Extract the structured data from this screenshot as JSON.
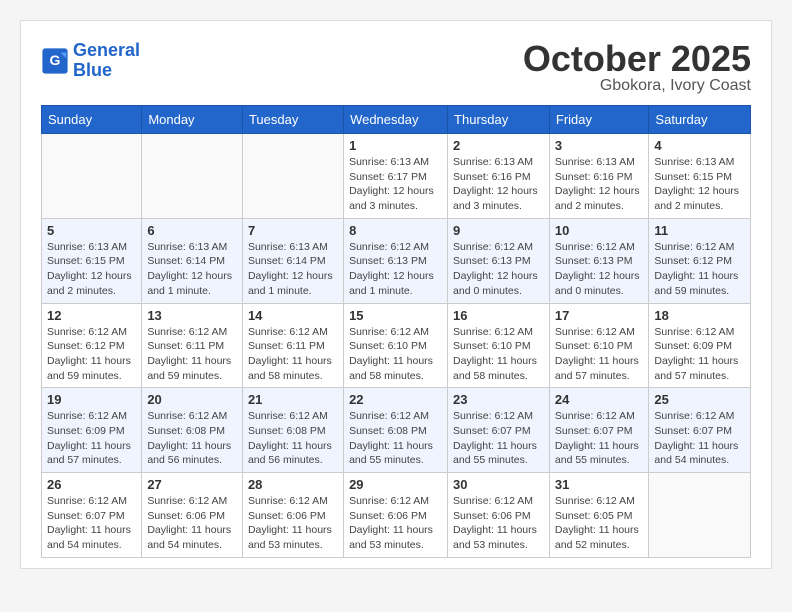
{
  "header": {
    "logo_text_general": "General",
    "logo_text_blue": "Blue",
    "month": "October 2025",
    "location": "Gbokora, Ivory Coast"
  },
  "weekdays": [
    "Sunday",
    "Monday",
    "Tuesday",
    "Wednesday",
    "Thursday",
    "Friday",
    "Saturday"
  ],
  "weeks": [
    [
      {
        "day": "",
        "info": ""
      },
      {
        "day": "",
        "info": ""
      },
      {
        "day": "",
        "info": ""
      },
      {
        "day": "1",
        "info": "Sunrise: 6:13 AM\nSunset: 6:17 PM\nDaylight: 12 hours and 3 minutes."
      },
      {
        "day": "2",
        "info": "Sunrise: 6:13 AM\nSunset: 6:16 PM\nDaylight: 12 hours and 3 minutes."
      },
      {
        "day": "3",
        "info": "Sunrise: 6:13 AM\nSunset: 6:16 PM\nDaylight: 12 hours and 2 minutes."
      },
      {
        "day": "4",
        "info": "Sunrise: 6:13 AM\nSunset: 6:15 PM\nDaylight: 12 hours and 2 minutes."
      }
    ],
    [
      {
        "day": "5",
        "info": "Sunrise: 6:13 AM\nSunset: 6:15 PM\nDaylight: 12 hours and 2 minutes."
      },
      {
        "day": "6",
        "info": "Sunrise: 6:13 AM\nSunset: 6:14 PM\nDaylight: 12 hours and 1 minute."
      },
      {
        "day": "7",
        "info": "Sunrise: 6:13 AM\nSunset: 6:14 PM\nDaylight: 12 hours and 1 minute."
      },
      {
        "day": "8",
        "info": "Sunrise: 6:12 AM\nSunset: 6:13 PM\nDaylight: 12 hours and 1 minute."
      },
      {
        "day": "9",
        "info": "Sunrise: 6:12 AM\nSunset: 6:13 PM\nDaylight: 12 hours and 0 minutes."
      },
      {
        "day": "10",
        "info": "Sunrise: 6:12 AM\nSunset: 6:13 PM\nDaylight: 12 hours and 0 minutes."
      },
      {
        "day": "11",
        "info": "Sunrise: 6:12 AM\nSunset: 6:12 PM\nDaylight: 11 hours and 59 minutes."
      }
    ],
    [
      {
        "day": "12",
        "info": "Sunrise: 6:12 AM\nSunset: 6:12 PM\nDaylight: 11 hours and 59 minutes."
      },
      {
        "day": "13",
        "info": "Sunrise: 6:12 AM\nSunset: 6:11 PM\nDaylight: 11 hours and 59 minutes."
      },
      {
        "day": "14",
        "info": "Sunrise: 6:12 AM\nSunset: 6:11 PM\nDaylight: 11 hours and 58 minutes."
      },
      {
        "day": "15",
        "info": "Sunrise: 6:12 AM\nSunset: 6:10 PM\nDaylight: 11 hours and 58 minutes."
      },
      {
        "day": "16",
        "info": "Sunrise: 6:12 AM\nSunset: 6:10 PM\nDaylight: 11 hours and 58 minutes."
      },
      {
        "day": "17",
        "info": "Sunrise: 6:12 AM\nSunset: 6:10 PM\nDaylight: 11 hours and 57 minutes."
      },
      {
        "day": "18",
        "info": "Sunrise: 6:12 AM\nSunset: 6:09 PM\nDaylight: 11 hours and 57 minutes."
      }
    ],
    [
      {
        "day": "19",
        "info": "Sunrise: 6:12 AM\nSunset: 6:09 PM\nDaylight: 11 hours and 57 minutes."
      },
      {
        "day": "20",
        "info": "Sunrise: 6:12 AM\nSunset: 6:08 PM\nDaylight: 11 hours and 56 minutes."
      },
      {
        "day": "21",
        "info": "Sunrise: 6:12 AM\nSunset: 6:08 PM\nDaylight: 11 hours and 56 minutes."
      },
      {
        "day": "22",
        "info": "Sunrise: 6:12 AM\nSunset: 6:08 PM\nDaylight: 11 hours and 55 minutes."
      },
      {
        "day": "23",
        "info": "Sunrise: 6:12 AM\nSunset: 6:07 PM\nDaylight: 11 hours and 55 minutes."
      },
      {
        "day": "24",
        "info": "Sunrise: 6:12 AM\nSunset: 6:07 PM\nDaylight: 11 hours and 55 minutes."
      },
      {
        "day": "25",
        "info": "Sunrise: 6:12 AM\nSunset: 6:07 PM\nDaylight: 11 hours and 54 minutes."
      }
    ],
    [
      {
        "day": "26",
        "info": "Sunrise: 6:12 AM\nSunset: 6:07 PM\nDaylight: 11 hours and 54 minutes."
      },
      {
        "day": "27",
        "info": "Sunrise: 6:12 AM\nSunset: 6:06 PM\nDaylight: 11 hours and 54 minutes."
      },
      {
        "day": "28",
        "info": "Sunrise: 6:12 AM\nSunset: 6:06 PM\nDaylight: 11 hours and 53 minutes."
      },
      {
        "day": "29",
        "info": "Sunrise: 6:12 AM\nSunset: 6:06 PM\nDaylight: 11 hours and 53 minutes."
      },
      {
        "day": "30",
        "info": "Sunrise: 6:12 AM\nSunset: 6:06 PM\nDaylight: 11 hours and 53 minutes."
      },
      {
        "day": "31",
        "info": "Sunrise: 6:12 AM\nSunset: 6:05 PM\nDaylight: 11 hours and 52 minutes."
      },
      {
        "day": "",
        "info": ""
      }
    ]
  ]
}
